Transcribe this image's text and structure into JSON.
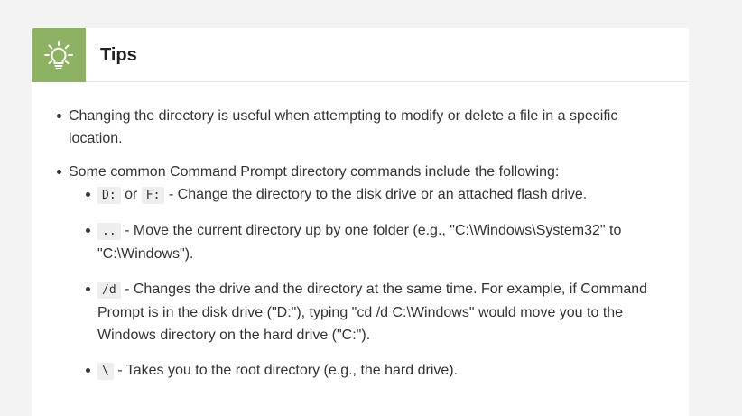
{
  "card": {
    "title": "Tips",
    "icon": "lightbulb-icon",
    "accent_color": "#8db263"
  },
  "tips": {
    "item1": "Changing the directory is useful when attempting to modify or delete a file in a specific location.",
    "item2_intro": "Some common Command Prompt directory commands include the following:",
    "commands": [
      {
        "code_a": "D:",
        "joiner": " or ",
        "code_b": "F:",
        "text": " - Change the directory to the disk drive or an attached flash drive."
      },
      {
        "code": "..",
        "text": " - Move the current directory up by one folder (e.g., \"C:\\Windows\\System32\" to \"C:\\Windows\")."
      },
      {
        "code": "/d",
        "text": " - Changes the drive and the directory at the same time. For example, if Command Prompt is in the disk drive (\"D:\"), typing \"cd /d C:\\Windows\" would move you to the Windows directory on the hard drive (\"C:\")."
      },
      {
        "code": "\\",
        "text": " - Takes you to the root directory (e.g., the hard drive)."
      }
    ]
  }
}
